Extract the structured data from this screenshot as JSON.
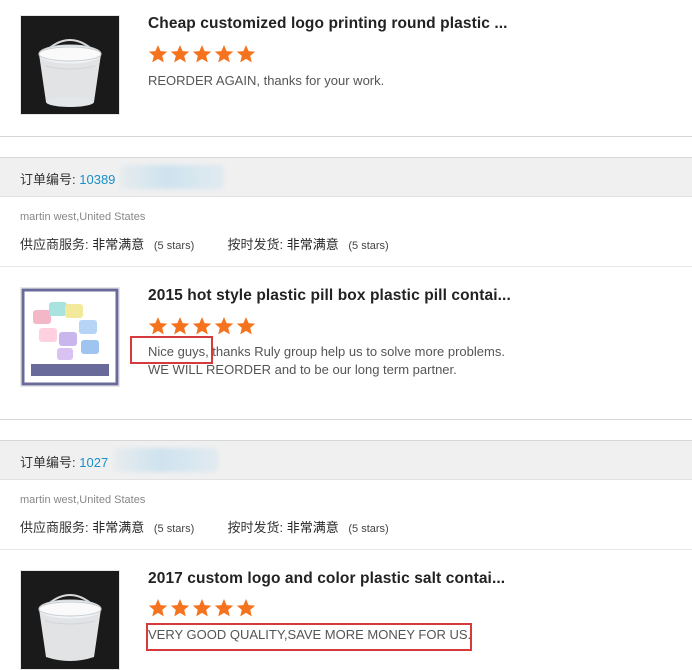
{
  "colors": {
    "star": "#f5731f",
    "link": "#1a8fc9",
    "highlight": "#d63a3a",
    "bar": "#f0f0f0"
  },
  "reviews": [
    {
      "title": "Cheap customized logo printing round plastic ...",
      "rating": 5,
      "comment": [
        "REORDER AGAIN, thanks for your work."
      ],
      "image": "plastic-bucket-image"
    },
    {
      "title": "2015 hot style plastic pill box plastic pill contai...",
      "rating": 5,
      "comment": [
        "Nice guys, thanks Ruly group help us to solve more problems.",
        "WE WILL REORDER and to be our long term partner."
      ],
      "image": "pill-box-image"
    },
    {
      "title": "2017 custom logo and color plastic salt contai...",
      "rating": 5,
      "comment": [
        "VERY GOOD QUALITY,SAVE MORE MONEY FOR US."
      ],
      "image": "plastic-bucket-image"
    }
  ],
  "orders": [
    {
      "label": "订单编号:",
      "number": "10389",
      "buyer": "martin west,United States",
      "supplier_service_label": "供应商服务:",
      "supplier_service_value": "非常满意",
      "supplier_service_stars": "(5 stars)",
      "on_time_label": "按时发货:",
      "on_time_value": "非常满意",
      "on_time_stars": "(5 stars)"
    },
    {
      "label": "订单编号:",
      "number": "1027",
      "buyer": "martin west,United States",
      "supplier_service_label": "供应商服务:",
      "supplier_service_value": "非常满意",
      "supplier_service_stars": "(5 stars)",
      "on_time_label": "按时发货:",
      "on_time_value": "非常满意",
      "on_time_stars": "(5 stars)"
    }
  ]
}
